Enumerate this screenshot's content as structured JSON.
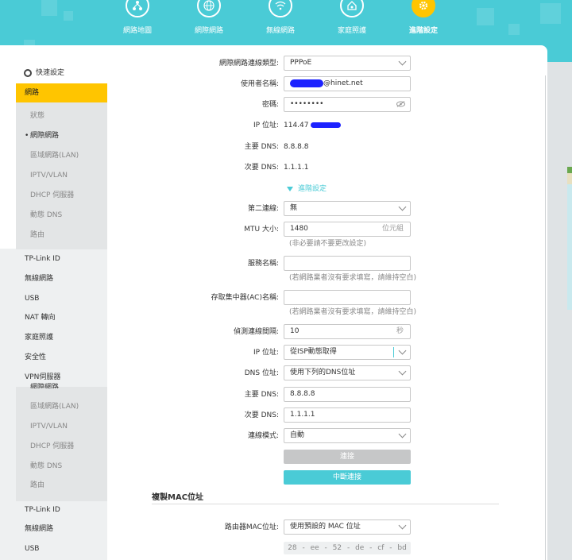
{
  "nav": {
    "items": [
      {
        "label": "網路地圖",
        "icon": "network-map-icon"
      },
      {
        "label": "網際網路",
        "icon": "globe-icon"
      },
      {
        "label": "無線網路",
        "icon": "wifi-icon"
      },
      {
        "label": "家庭照護",
        "icon": "home-care-icon"
      },
      {
        "label": "進階設定",
        "icon": "gear-icon"
      }
    ]
  },
  "sidebar": {
    "quick_setup": "快速設定",
    "network": "網路",
    "sub1": [
      "狀態",
      "網際網路",
      "區域網路(LAN)",
      "IPTV/VLAN",
      "DHCP 伺服器",
      "動態 DNS",
      "路由"
    ],
    "items1": [
      "TP-Link ID",
      "無線網路",
      "USB",
      "NAT 轉向",
      "家庭照護",
      "安全性",
      "VPN伺服器"
    ],
    "sub2_partial": "網際網路",
    "sub2": [
      "區域網路(LAN)",
      "IPTV/VLAN",
      "DHCP 伺服器",
      "動態 DNS",
      "路由"
    ],
    "items2": [
      "TP-Link ID",
      "無線網路",
      "USB"
    ]
  },
  "form": {
    "conn_type_label": "網際網路連線類型:",
    "conn_type": "PPPoE",
    "username_label": "使用者名稱:",
    "username_suffix": "@hinet.net",
    "password_label": "密碼:",
    "password": "••••••••",
    "ip_label": "IP 位址:",
    "ip_prefix": "114.47",
    "dns1_label": "主要 DNS:",
    "dns1": "8.8.8.8",
    "dns2_label": "次要 DNS:",
    "dns2": "1.1.1.1",
    "advanced_label": "進階設定",
    "second_conn_label": "第二連線:",
    "second_conn": "無",
    "mtu_label": "MTU 大小:",
    "mtu": "1480",
    "mtu_unit": "位元組",
    "mtu_hint": "(非必要請不要更改設定)",
    "service_label": "服務名稱:",
    "service_hint": "(若網路業者沒有要求填寫，請維持空白)",
    "ac_label": "存取集中器(AC)名稱:",
    "ac_hint": "(若網路業者沒有要求填寫，請維持空白)",
    "echo_label": "偵測連線間隔:",
    "echo": "10",
    "echo_unit": "秒",
    "ip_mode_label": "IP 位址:",
    "ip_mode": "從ISP動態取得",
    "dns_mode_label": "DNS 位址:",
    "dns_mode": "使用下列的DNS位址",
    "pdns_label": "主要 DNS:",
    "pdns": "8.8.8.8",
    "sdns_label": "次要 DNS:",
    "sdns": "1.1.1.1",
    "conn_mode_label": "連線模式:",
    "conn_mode": "自動",
    "connect_btn": "連接",
    "disconnect_btn": "中斷連接",
    "mac_section": "複製MAC位址",
    "router_mac_label": "路由器MAC位址:",
    "router_mac_mode": "使用預設的 MAC 位址",
    "mac_value": "28 - ee - 52 - de - cf - bd"
  },
  "colors": {
    "accent": "#4acbd6",
    "selected": "#ffc500"
  }
}
